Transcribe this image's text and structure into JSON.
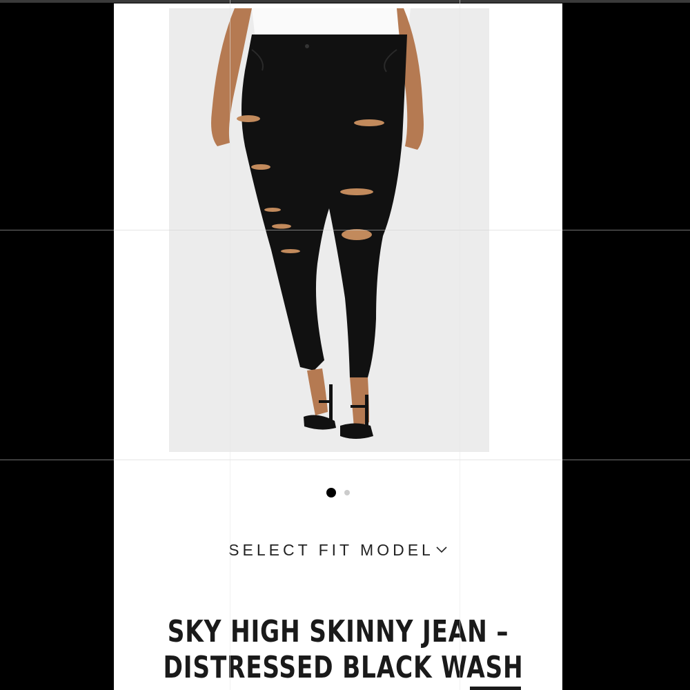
{
  "product": {
    "image_alt": "Woman wearing black distressed skinny jeans and black heeled sandals",
    "title_line1": "SKY HIGH SKINNY JEAN –",
    "title_line2": "DISTRESSED BLACK WASH"
  },
  "carousel": {
    "total_images": 2,
    "active_index": 0
  },
  "fit_select": {
    "label": "SELECT FIT MODEL",
    "icon": "chevron-down-icon"
  },
  "colors": {
    "page_background": "#ffffff",
    "letterbox": "#000000",
    "photo_background": "#ececec",
    "dot_active": "#000000",
    "dot_inactive": "#cccccc",
    "text": "#1a1a1a"
  }
}
